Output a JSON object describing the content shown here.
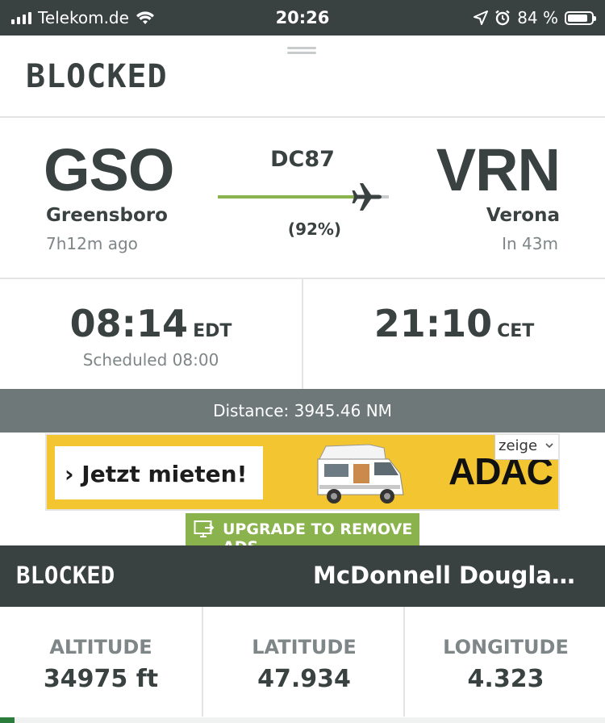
{
  "status_bar": {
    "carrier": "Telekom.de",
    "time": "20:26",
    "battery": "84 %",
    "battery_level": 0.84
  },
  "header": {
    "title": "BLOCKED"
  },
  "route": {
    "origin": {
      "code": "GSO",
      "city": "Greensboro",
      "relative": "7h12m ago"
    },
    "destination": {
      "code": "VRN",
      "city": "Verona",
      "relative": "In 43m"
    },
    "flight_number": "DC87",
    "progress_label": "(92%)",
    "progress": 0.92
  },
  "times": {
    "departure": {
      "time": "08:14",
      "tz": "EDT",
      "scheduled": "Scheduled 08:00"
    },
    "arrival": {
      "time": "21:10",
      "tz": "CET"
    }
  },
  "distance": "Distance: 3945.46 NM",
  "ad": {
    "cta": "› Jetzt mieten!",
    "brand": "ADAC",
    "tag": "zeige",
    "upgrade_label": "UPGRADE TO REMOVE ADS"
  },
  "aircraft": {
    "status": "BLOCKED",
    "type": "McDonnell Douglas D..."
  },
  "stats": [
    {
      "label": "ALTITUDE",
      "value": "34975 ft"
    },
    {
      "label": "LATITUDE",
      "value": "47.934"
    },
    {
      "label": "LONGITUDE",
      "value": "4.323"
    }
  ],
  "colors": {
    "dark": "#3a4141",
    "accent_green": "#8ab34e",
    "distance_bar": "#6f7878",
    "ad_yellow": "#f2c531"
  }
}
